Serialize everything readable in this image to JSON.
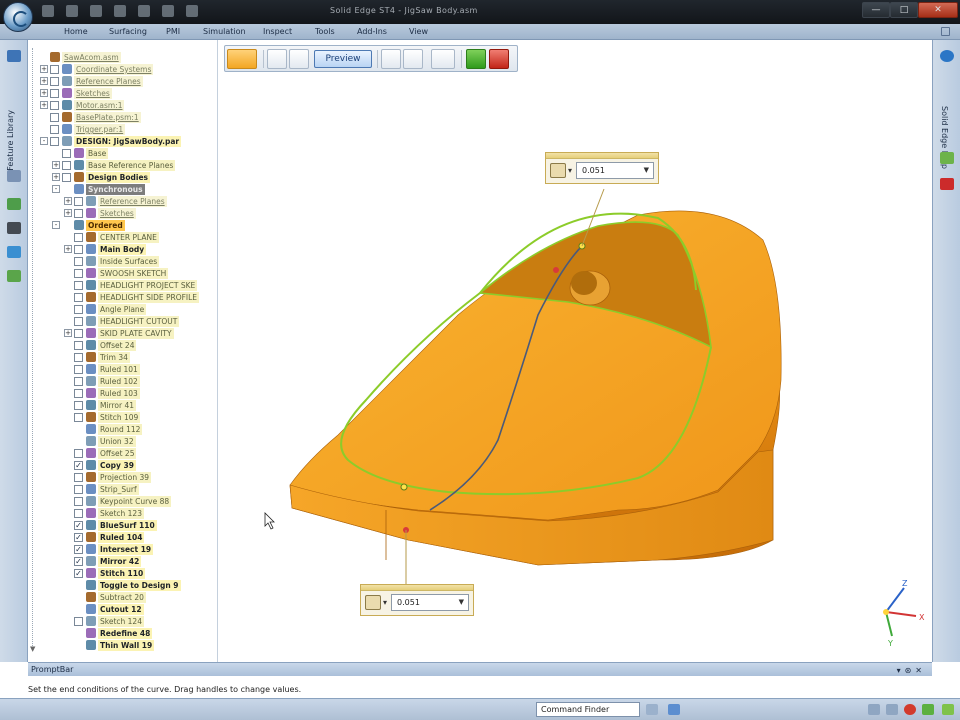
{
  "app": {
    "title": "Solid Edge ST4 - JigSaw Body.asm"
  },
  "ribbon": {
    "tabs": [
      "Home",
      "Surfacing",
      "PMI",
      "Simulation",
      "Inspect",
      "Tools",
      "Add-Ins",
      "View"
    ]
  },
  "left_panel": {
    "vertical_tab": "Feature Library"
  },
  "right_panel": {
    "vertical_tab": "Solid Edge Help"
  },
  "tree": {
    "rows": [
      {
        "label": "SawAcom.asm",
        "style": "dim",
        "depth": 0,
        "expander": "",
        "checkbox": false
      },
      {
        "label": "Coordinate Systems",
        "style": "dim",
        "depth": 1,
        "expander": "+",
        "checkbox": true
      },
      {
        "label": "Reference Planes",
        "style": "dim",
        "depth": 1,
        "expander": "+",
        "checkbox": true
      },
      {
        "label": "Sketches",
        "style": "dim",
        "depth": 1,
        "expander": "+",
        "checkbox": true
      },
      {
        "label": "Motor.asm:1",
        "style": "dim",
        "depth": 1,
        "expander": "+",
        "checkbox": true
      },
      {
        "label": "BasePlate.psm:1",
        "style": "dim",
        "depth": 1,
        "expander": "",
        "checkbox": true
      },
      {
        "label": "Trigger.par:1",
        "style": "dim",
        "depth": 1,
        "expander": "",
        "checkbox": true
      },
      {
        "label": "DESIGN: JigSawBody.par",
        "style": "bold",
        "depth": 1,
        "expander": "-",
        "checkbox": true
      },
      {
        "label": "Base",
        "style": "normal",
        "depth": 2,
        "expander": "",
        "checkbox": true
      },
      {
        "label": "Base Reference Planes",
        "style": "normal",
        "depth": 2,
        "expander": "+",
        "checkbox": true
      },
      {
        "label": "Design Bodies",
        "style": "bold",
        "depth": 2,
        "expander": "+",
        "checkbox": true
      },
      {
        "label": "Synchronous",
        "style": "dark",
        "depth": 2,
        "expander": "-",
        "checkbox": false
      },
      {
        "label": "Reference Planes",
        "style": "dim",
        "depth": 3,
        "expander": "+",
        "checkbox": true
      },
      {
        "label": "Sketches",
        "style": "dim",
        "depth": 3,
        "expander": "+",
        "checkbox": true
      },
      {
        "label": "Ordered",
        "style": "orange",
        "depth": 2,
        "expander": "-",
        "checkbox": false
      },
      {
        "label": "CENTER PLANE",
        "style": "normal",
        "depth": 3,
        "expander": "",
        "checkbox": true
      },
      {
        "label": "Main Body",
        "style": "bold",
        "depth": 3,
        "expander": "+",
        "checkbox": true
      },
      {
        "label": "Inside Surfaces",
        "style": "normal",
        "depth": 3,
        "expander": "",
        "checkbox": true
      },
      {
        "label": "SWOOSH SKETCH",
        "style": "normal",
        "depth": 3,
        "expander": "",
        "checkbox": true
      },
      {
        "label": "HEADLIGHT PROJECT SKE",
        "style": "normal",
        "depth": 3,
        "expander": "",
        "checkbox": true
      },
      {
        "label": "HEADLIGHT SIDE PROFILE",
        "style": "normal",
        "depth": 3,
        "expander": "",
        "checkbox": true
      },
      {
        "label": "Angle Plane",
        "style": "normal",
        "depth": 3,
        "expander": "",
        "checkbox": true
      },
      {
        "label": "HEADLIGHT CUTOUT",
        "style": "normal",
        "depth": 3,
        "expander": "",
        "checkbox": true
      },
      {
        "label": "SKID PLATE CAVITY",
        "style": "normal",
        "depth": 3,
        "expander": "+",
        "checkbox": true
      },
      {
        "label": "Offset 24",
        "style": "normal",
        "depth": 3,
        "expander": "",
        "checkbox": true
      },
      {
        "label": "Trim 34",
        "style": "normal",
        "depth": 3,
        "expander": "",
        "checkbox": true
      },
      {
        "label": "Ruled 101",
        "style": "normal",
        "depth": 3,
        "expander": "",
        "checkbox": true
      },
      {
        "label": "Ruled 102",
        "style": "normal",
        "depth": 3,
        "expander": "",
        "checkbox": true
      },
      {
        "label": "Ruled 103",
        "style": "normal",
        "depth": 3,
        "expander": "",
        "checkbox": true
      },
      {
        "label": "Mirror 41",
        "style": "normal",
        "depth": 3,
        "expander": "",
        "checkbox": true
      },
      {
        "label": "Stitch 109",
        "style": "normal",
        "depth": 3,
        "expander": "",
        "checkbox": true
      },
      {
        "label": "Round 112",
        "style": "normal",
        "depth": 3,
        "expander": "",
        "checkbox": false
      },
      {
        "label": "Union 32",
        "style": "normal",
        "depth": 3,
        "expander": "",
        "checkbox": false
      },
      {
        "label": "Offset 25",
        "style": "normal",
        "depth": 3,
        "expander": "",
        "checkbox": true
      },
      {
        "label": "Copy 39",
        "style": "bold",
        "depth": 3,
        "expander": "",
        "checkbox": "checked"
      },
      {
        "label": "Projection 39",
        "style": "normal",
        "depth": 3,
        "expander": "",
        "checkbox": true
      },
      {
        "label": "Strip_Surf",
        "style": "normal",
        "depth": 3,
        "expander": "",
        "checkbox": true
      },
      {
        "label": "Keypoint Curve 88",
        "style": "normal",
        "depth": 3,
        "expander": "",
        "checkbox": true
      },
      {
        "label": "Sketch 123",
        "style": "normal",
        "depth": 3,
        "expander": "",
        "checkbox": true
      },
      {
        "label": "BlueSurf 110",
        "style": "bold",
        "depth": 3,
        "expander": "",
        "checkbox": "checked"
      },
      {
        "label": "Ruled 104",
        "style": "bold",
        "depth": 3,
        "expander": "",
        "checkbox": "checked"
      },
      {
        "label": "Intersect 19",
        "style": "bold",
        "depth": 3,
        "expander": "",
        "checkbox": "checked"
      },
      {
        "label": "Mirror 42",
        "style": "bold",
        "depth": 3,
        "expander": "",
        "checkbox": "checked"
      },
      {
        "label": "Stitch 110",
        "style": "bold",
        "depth": 3,
        "expander": "",
        "checkbox": "checked"
      },
      {
        "label": "Toggle to Design 9",
        "style": "bold",
        "depth": 3,
        "expander": "",
        "checkbox": false
      },
      {
        "label": "Subtract 20",
        "style": "normal",
        "depth": 3,
        "expander": "",
        "checkbox": false
      },
      {
        "label": "Cutout 12",
        "style": "bold",
        "depth": 3,
        "expander": "",
        "checkbox": false
      },
      {
        "label": "Sketch 124",
        "style": "normal",
        "depth": 3,
        "expander": "",
        "checkbox": true
      },
      {
        "label": "Redefine 48",
        "style": "bold",
        "depth": 3,
        "expander": "",
        "checkbox": false
      },
      {
        "label": "Thin Wall 19",
        "style": "bold",
        "depth": 3,
        "expander": "",
        "checkbox": false
      }
    ]
  },
  "command_bar": {
    "preview_label": "Preview"
  },
  "dimensions": {
    "top": {
      "value": "0.051"
    },
    "bottom": {
      "value": "0.051"
    }
  },
  "triad": {
    "x_label": "X",
    "y_label": "Y",
    "z_label": "Z"
  },
  "promptbar": {
    "title": "PromptBar",
    "message": "Set the end conditions of the curve. Drag handles to change values."
  },
  "statusbar": {
    "command_finder": "Command Finder"
  },
  "colors": {
    "model": "#f2a024",
    "edge_highlight": "#8ccc2a",
    "tree_label_bg": "#f6f2c2",
    "ordered_bg": "#ffc74d",
    "ribbon": "#b8c9dc"
  }
}
